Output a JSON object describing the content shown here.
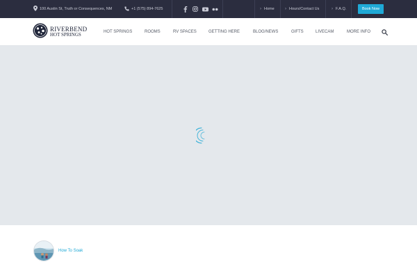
{
  "topbar": {
    "address": "100 Austin St, Truth or Consequences, NM",
    "phone": "+1 (575) 894-7625",
    "social": [
      "facebook-icon",
      "instagram-icon",
      "youtube-icon",
      "flickr-icon"
    ],
    "links": [
      "Home",
      "Hours/Contact Us",
      "F.A.Q."
    ],
    "book_label": "Book Now"
  },
  "logo": {
    "line1": "RIVERBEND",
    "line2": "HOT SPRINGS"
  },
  "nav": {
    "items": [
      "HOT SPRINGS",
      "ROOMS",
      "RV SPACES",
      "GETTING HERE",
      "BLOG/NEWS",
      "GIFTS",
      "LIVECAM",
      "MORE INFO"
    ]
  },
  "post": {
    "title": "How To Soak"
  },
  "colors": {
    "topbar_bg": "#2b2d3f",
    "accent": "#1fa9d6",
    "slider_bg": "#e4e8ec"
  }
}
